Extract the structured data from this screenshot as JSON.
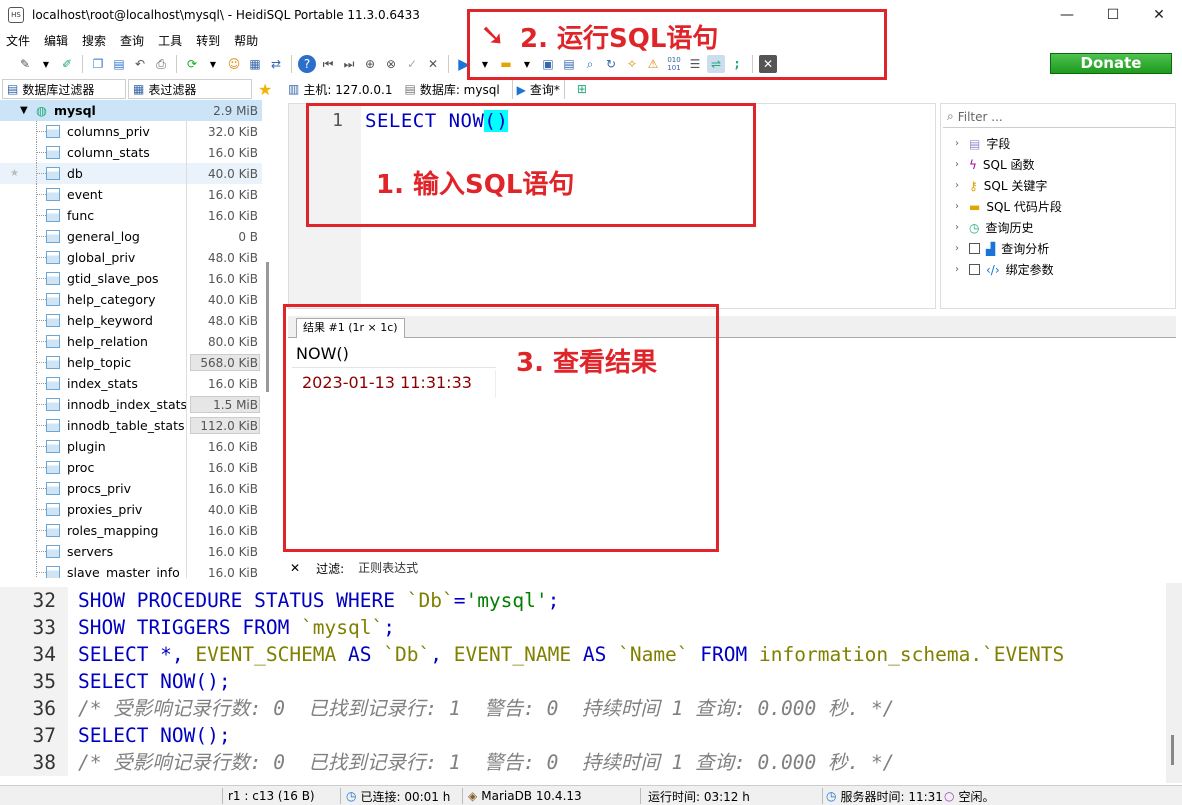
{
  "window": {
    "title": "localhost\\root@localhost\\mysql\\ - HeidiSQL Portable 11.3.0.6433",
    "app_icon_text": "HS",
    "min_glyph": "—",
    "max_glyph": "☐",
    "close_glyph": "✕"
  },
  "menu": [
    "文件",
    "编辑",
    "搜索",
    "查询",
    "工具",
    "转到",
    "帮助"
  ],
  "donate_label": "Donate",
  "left_panel": {
    "db_filter": "数据库过滤器",
    "table_filter": "表过滤器",
    "database": {
      "name": "mysql",
      "size": "2.9 MiB"
    },
    "tables": [
      {
        "name": "columns_priv",
        "size": "32.0 KiB"
      },
      {
        "name": "column_stats",
        "size": "16.0 KiB"
      },
      {
        "name": "db",
        "size": "40.0 KiB"
      },
      {
        "name": "event",
        "size": "16.0 KiB"
      },
      {
        "name": "func",
        "size": "16.0 KiB"
      },
      {
        "name": "general_log",
        "size": "0 B"
      },
      {
        "name": "global_priv",
        "size": "48.0 KiB"
      },
      {
        "name": "gtid_slave_pos",
        "size": "16.0 KiB"
      },
      {
        "name": "help_category",
        "size": "40.0 KiB"
      },
      {
        "name": "help_keyword",
        "size": "48.0 KiB"
      },
      {
        "name": "help_relation",
        "size": "80.0 KiB"
      },
      {
        "name": "help_topic",
        "size": "568.0 KiB"
      },
      {
        "name": "index_stats",
        "size": "16.0 KiB"
      },
      {
        "name": "innodb_index_stats",
        "size": "1.5 MiB"
      },
      {
        "name": "innodb_table_stats",
        "size": "112.0 KiB"
      },
      {
        "name": "plugin",
        "size": "16.0 KiB"
      },
      {
        "name": "proc",
        "size": "16.0 KiB"
      },
      {
        "name": "procs_priv",
        "size": "16.0 KiB"
      },
      {
        "name": "proxies_priv",
        "size": "40.0 KiB"
      },
      {
        "name": "roles_mapping",
        "size": "16.0 KiB"
      },
      {
        "name": "servers",
        "size": "16.0 KiB"
      },
      {
        "name": "slave_master_info",
        "size": "16.0 KiB"
      }
    ]
  },
  "doc_tabs": {
    "host": "主机: 127.0.0.1",
    "database": "数据库: mysql",
    "query": "查询*"
  },
  "editor": {
    "line_number": "1",
    "keyword1": "SELECT",
    "func": "NOW",
    "parens": "()"
  },
  "helper": {
    "filter_placeholder": "Filter ...",
    "items": [
      "字段",
      "SQL 函数",
      "SQL 关键字",
      "SQL 代码片段",
      "查询历史",
      "查询分析",
      "绑定参数"
    ]
  },
  "results": {
    "tab_label": "结果 #1 (1r × 1c)",
    "column": "NOW()",
    "value": "2023-01-13 11:31:33"
  },
  "filter_bar": {
    "close_glyph": "✕",
    "label": "过滤:",
    "placeholder": "正则表达式"
  },
  "log": {
    "line_numbers": [
      "32",
      "33",
      "34",
      "35",
      "36",
      "37",
      "38"
    ],
    "l32_a": "SHOW PROCEDURE STATUS WHERE ",
    "l32_b": "`Db`",
    "l32_c": "=",
    "l32_d": "'mysql'",
    "l32_e": ";",
    "l33_a": "SHOW TRIGGERS FROM ",
    "l33_b": "`mysql`",
    "l33_c": ";",
    "l34_a": "SELECT *, ",
    "l34_b": "EVENT_SCHEMA",
    "l34_c": " AS ",
    "l34_d": "`Db`",
    "l34_e": ", ",
    "l34_f": "EVENT_NAME",
    "l34_g": " AS ",
    "l34_h": "`Name`",
    "l34_i": " FROM ",
    "l34_j": "information_schema.`EVENTS",
    "l35": "SELECT NOW();",
    "l36": "/* 受影响记录行数: 0  已找到记录行: 1  警告: 0  持续时间 1 查询: 0.000 秒. */",
    "l37": "SELECT NOW();",
    "l38": "/* 受影响记录行数: 0  已找到记录行: 1  警告: 0  持续时间 1 查询: 0.000 秒. */"
  },
  "status": {
    "position": "r1 : c13 (16 B)",
    "connected": "已连接: 00:01 h",
    "server": "MariaDB 10.4.13",
    "uptime": "运行时间: 03:12 h",
    "server_time": "服务器时间: 11:31",
    "idle": "空闲。"
  },
  "annotations": {
    "step1": "1. 输入SQL语句",
    "step2": "2. 运行SQL语句",
    "step3": "3. 查看结果"
  },
  "colors": {
    "annotation_red": "#e0252a",
    "keyword_blue": "#0000c0",
    "identifier_olive": "#808000",
    "string_green": "#008000",
    "result_value": "#8b0000",
    "donate_green": "#2aa52a",
    "paren_highlight": "#00ffff"
  }
}
